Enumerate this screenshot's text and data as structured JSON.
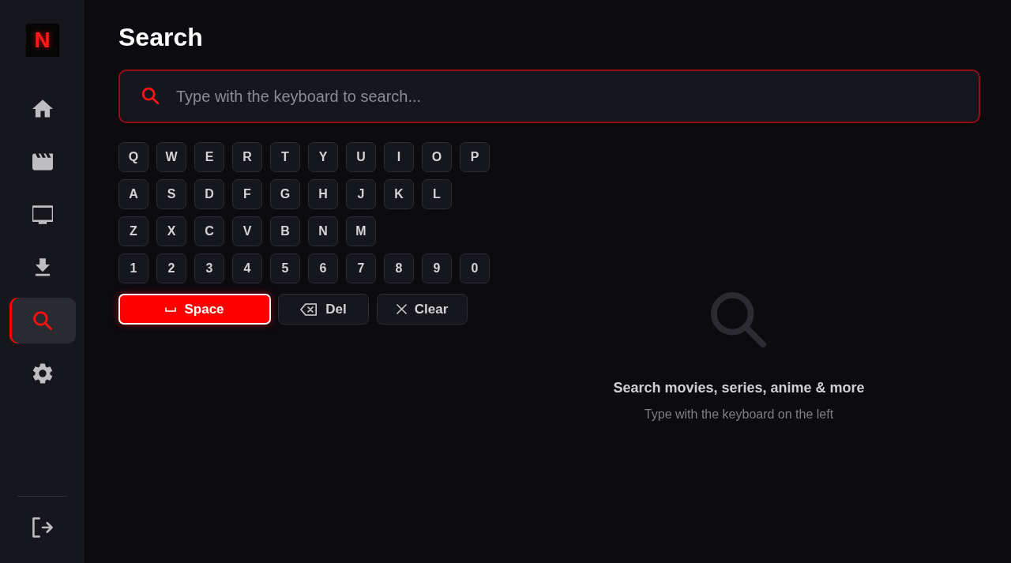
{
  "sidebar": {
    "logo": "N",
    "nav": [
      {
        "kind": "home",
        "selected": false
      },
      {
        "kind": "movies",
        "selected": false
      },
      {
        "kind": "tv",
        "selected": false
      },
      {
        "kind": "downloads",
        "selected": false
      },
      {
        "kind": "search",
        "selected": true
      },
      {
        "kind": "settings",
        "selected": false
      }
    ],
    "bottom": [
      {
        "kind": "logout",
        "selected": false
      }
    ]
  },
  "page": {
    "title": "Search"
  },
  "search": {
    "placeholder": "Type with the keyboard to search..."
  },
  "keyboard": {
    "rows": [
      [
        {
          "label": "Q",
          "focused": false
        },
        {
          "label": "W",
          "focused": false
        },
        {
          "label": "E",
          "focused": false
        },
        {
          "label": "R",
          "focused": false
        },
        {
          "label": "T",
          "focused": false
        },
        {
          "label": "Y",
          "focused": false
        },
        {
          "label": "U",
          "focused": false
        },
        {
          "label": "I",
          "focused": false
        },
        {
          "label": "O",
          "focused": false
        },
        {
          "label": "P",
          "focused": false
        }
      ],
      [
        {
          "label": "A",
          "focused": false
        },
        {
          "label": "S",
          "focused": false
        },
        {
          "label": "D",
          "focused": false
        },
        {
          "label": "F",
          "focused": false
        },
        {
          "label": "G",
          "focused": false
        },
        {
          "label": "H",
          "focused": false
        },
        {
          "label": "J",
          "focused": false
        },
        {
          "label": "K",
          "focused": false
        },
        {
          "label": "L",
          "focused": false
        }
      ],
      [
        {
          "label": "Z",
          "focused": false
        },
        {
          "label": "X",
          "focused": false
        },
        {
          "label": "C",
          "focused": false
        },
        {
          "label": "V",
          "focused": false
        },
        {
          "label": "B",
          "focused": false
        },
        {
          "label": "N",
          "focused": false
        },
        {
          "label": "M",
          "focused": false
        }
      ],
      [
        {
          "label": "1",
          "focused": false
        },
        {
          "label": "2",
          "focused": false
        },
        {
          "label": "3",
          "focused": false
        },
        {
          "label": "4",
          "focused": false
        },
        {
          "label": "5",
          "focused": false
        },
        {
          "label": "6",
          "focused": false
        },
        {
          "label": "7",
          "focused": false
        },
        {
          "label": "8",
          "focused": false
        },
        {
          "label": "9",
          "focused": false
        },
        {
          "label": "0",
          "focused": false
        }
      ]
    ],
    "actions": [
      {
        "kind": "space",
        "label": "Space",
        "focused": true
      },
      {
        "kind": "delete",
        "label": "Del",
        "focused": false
      },
      {
        "kind": "clear",
        "label": "Clear",
        "focused": false
      }
    ]
  },
  "empty_state": {
    "title": "Search movies, series, anime & more",
    "subtitle": "Type with the keyboard on the left"
  }
}
